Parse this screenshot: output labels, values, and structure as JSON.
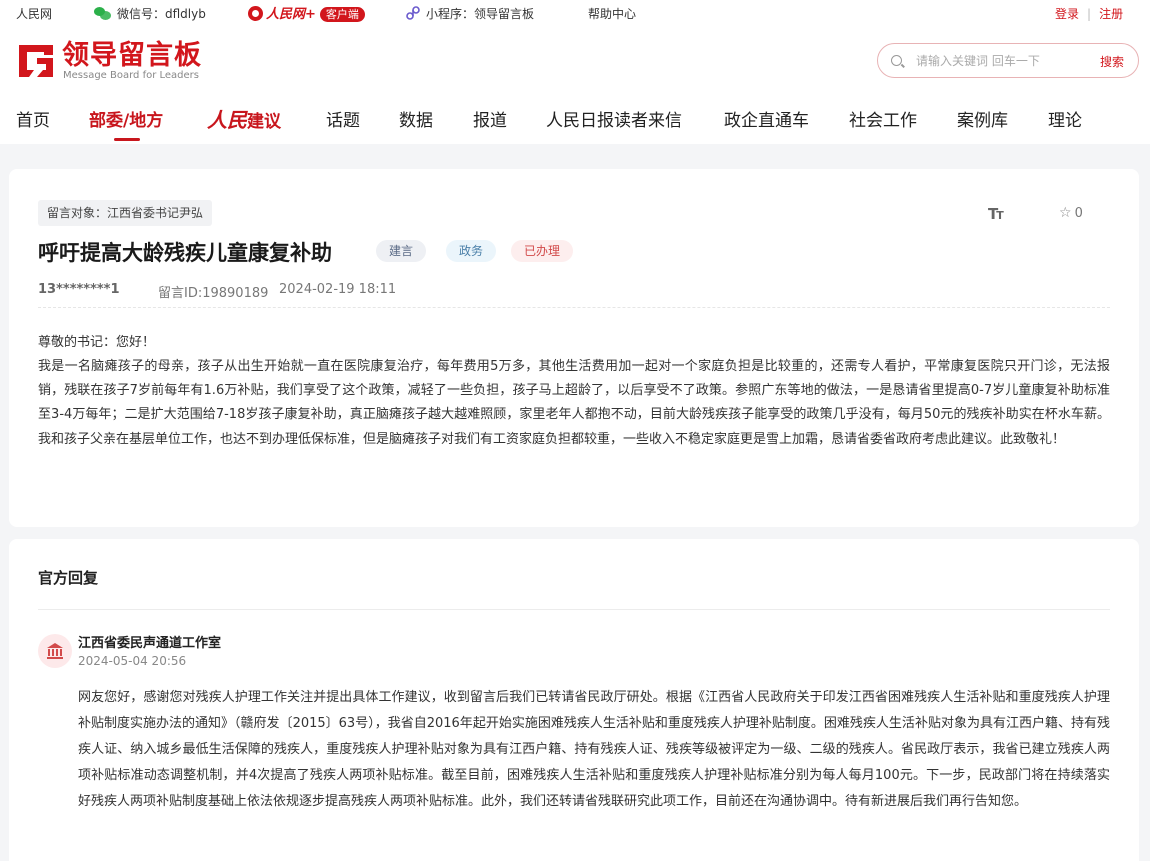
{
  "topbar": {
    "site": "人民网",
    "wechat_label": "微信号：dfldlyb",
    "rm_logo_text": "人民网+",
    "client_badge": "客户端",
    "miniprogram_label": "小程序：领导留言板",
    "help": "帮助中心",
    "login": "登录",
    "separator": "|",
    "register": "注册"
  },
  "logo": {
    "cn": "领导留言板",
    "en": "Message Board for Leaders"
  },
  "search": {
    "placeholder": "请输入关键词 回车一下",
    "button": "搜索"
  },
  "nav": {
    "items": [
      "首页",
      "部委/地方",
      "人民建议",
      "话题",
      "数据",
      "报道",
      "人民日报读者来信",
      "政企直通车",
      "社会工作",
      "案例库",
      "理论"
    ],
    "rm_prefix": "人民",
    "rm_suffix": "建议",
    "active_index": 1
  },
  "message": {
    "target": "留言对象：江西省委书记尹弘",
    "font_size_label": "TT",
    "favorites": "0",
    "title": "呼吁提高大龄残疾儿童康复补助",
    "badges": [
      "建言",
      "政务",
      "已办理"
    ],
    "user": "13********1",
    "message_id": "留言ID:19890189",
    "time": "2024-02-19 18:11",
    "greeting": "尊敬的书记：您好！",
    "body": "我是一名脑瘫孩子的母亲，孩子从出生开始就一直在医院康复治疗，每年费用5万多，其他生活费用加一起对一个家庭负担是比较重的，还需专人看护，平常康复医院只开门诊，无法报销，残联在孩子7岁前每年有1.6万补贴，我们享受了这个政策，减轻了一些负担，孩子马上超龄了，以后享受不了政策。参照广东等地的做法，一是恳请省里提高0-7岁儿童康复补助标准至3-4万每年；二是扩大范围给7-18岁孩子康复补助，真正脑瘫孩子越大越难照顾，家里老年人都抱不动，目前大龄残疾孩子能享受的政策几乎没有，每月50元的残疾补助实在杯水车薪。我和孩子父亲在基层单位工作，也达不到办理低保标准，但是脑瘫孩子对我们有工资家庭负担都较重，一些收入不稳定家庭更是雪上加霜，恳请省委省政府考虑此建议。此致敬礼！"
  },
  "reply": {
    "heading": "官方回复",
    "org": "江西省委民声通道工作室",
    "time": "2024-05-04 20:56",
    "body": "网友您好，感谢您对残疾人护理工作关注并提出具体工作建议，收到留言后我们已转请省民政厅研处。根据《江西省人民政府关于印发江西省困难残疾人生活补贴和重度残疾人护理补贴制度实施办法的通知》（赣府发〔2015〕63号），我省自2016年起开始实施困难残疾人生活补贴和重度残疾人护理补贴制度。困难残疾人生活补贴对象为具有江西户籍、持有残疾人证、纳入城乡最低生活保障的残疾人，重度残疾人护理补贴对象为具有江西户籍、持有残疾人证、残疾等级被评定为一级、二级的残疾人。省民政厅表示，我省已建立残疾人两项补贴标准动态调整机制，并4次提高了残疾人两项补贴标准。截至目前，困难残疾人生活补贴和重度残疾人护理补贴标准分别为每人每月100元。下一步，民政部门将在持续落实好残疾人两项补贴制度基础上依法依规逐步提高残疾人两项补贴标准。此外，我们还转请省残联研究此项工作，目前还在沟通协调中。待有新进展后我们再行告知您。"
  },
  "colors": {
    "brand_red": "#c8161d",
    "page_bg": "#f4f5f7"
  }
}
